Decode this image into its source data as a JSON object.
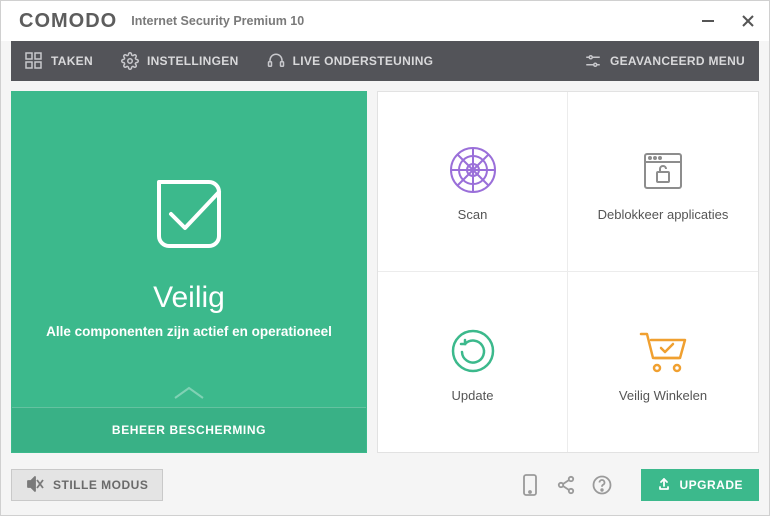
{
  "titlebar": {
    "logo": "COMODO",
    "product": "Internet Security Premium 10"
  },
  "menubar": {
    "tasks": "TAKEN",
    "settings": "INSTELLINGEN",
    "live_support": "LIVE ONDERSTEUNING",
    "advanced": "GEAVANCEERD MENU"
  },
  "status": {
    "title": "Veilig",
    "subtitle": "Alle componenten zijn actief en operationeel",
    "manage": "BEHEER BESCHERMING"
  },
  "actions": {
    "scan": "Scan",
    "unblock": "Deblokkeer applicaties",
    "update": "Update",
    "shop": "Veilig Winkelen"
  },
  "footer": {
    "silent": "STILLE MODUS",
    "upgrade": "UPGRADE"
  },
  "colors": {
    "accent": "#3cb98c",
    "menubar": "#535459"
  }
}
